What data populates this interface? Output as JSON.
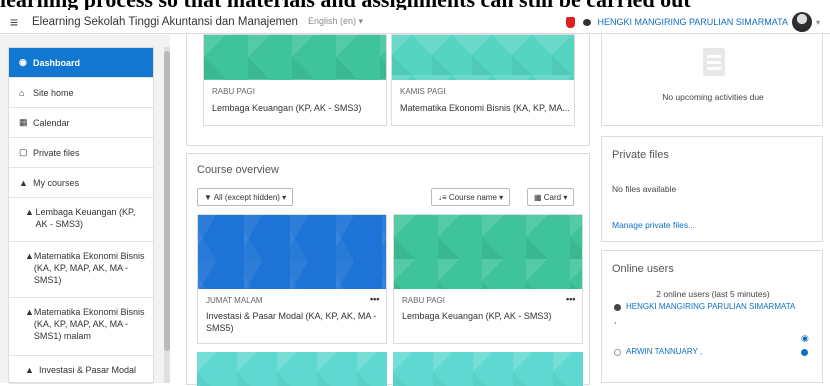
{
  "caption": "learning process so that materials and assignments can still be carried out",
  "navbar": {
    "menu_icon": "hamburger-icon",
    "site_name": "Elearning Sekolah Tinggi Akuntansi dan Manajemen",
    "language": "English (en) ▾",
    "user_name": "HENGKI MANGIRING PARULIAN SIMARMATA",
    "caret": "▾"
  },
  "drawer": {
    "dashboard": "Dashboard",
    "site_home": "Site home",
    "calendar": "Calendar",
    "private_files": "Private files",
    "my_courses": "My courses",
    "courses": [
      "Lembaga Keuangan (KP, AK - SMS3)",
      "Matematika Ekonomi Bisnis (KA, KP, MAP, AK, MA - SMS1)",
      "Matematika Ekonomi Bisnis (KA, KP, MAP, AK, MA - SMS1) malam",
      "Investasi & Pasar Modal"
    ]
  },
  "recent": {
    "card1": {
      "category": "RABU PAGI",
      "name": "Lembaga Keuangan (KP, AK - SMS3)"
    },
    "card2": {
      "category": "KAMIS PAGI",
      "name": "Matematika Ekonomi Bisnis (KA, KP, MA..."
    }
  },
  "overview": {
    "title": "Course overview",
    "filter": "▼ All (except hidden) ▾",
    "sort": "Course name ▾",
    "view": "Card ▾",
    "card1": {
      "category": "JUMAT MALAM",
      "name": "Investasi & Pasar Modal (KA, KP, AK, MA - SMS5)",
      "menu": "•••"
    },
    "card2": {
      "category": "RABU PAGI",
      "name": "Lembaga Keuangan (KP, AK - SMS3)",
      "menu": "•••"
    }
  },
  "timeline": {
    "empty": "No upcoming activities due"
  },
  "private_files": {
    "title": "Private files",
    "empty": "No files available",
    "manage": "Manage private files..."
  },
  "online_users": {
    "title": "Online users",
    "summary": "2 online users (last 5 minutes)",
    "user1": "HENGKI MANGIRING PARULIAN SIMARMATA",
    "user1_suffix": ",",
    "user2": "ARWIN TANNUARY ,"
  },
  "colors": {
    "brand": "#1177d1",
    "link": "#0f6fc5",
    "notification": "#e02020"
  }
}
